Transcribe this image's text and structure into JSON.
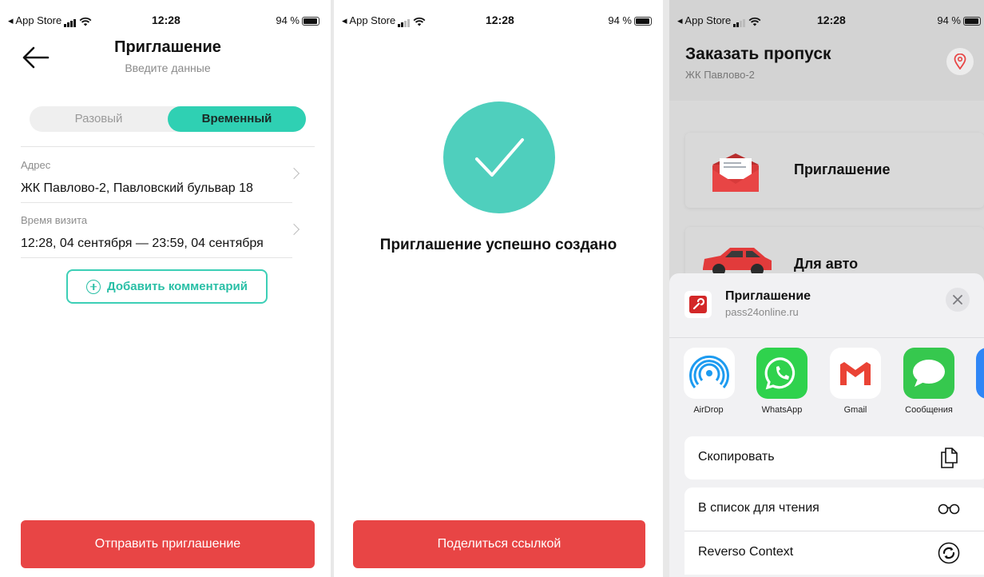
{
  "status_bar": {
    "back_app": "◂ App Store",
    "time": "12:28",
    "battery": "94 %"
  },
  "invite_screen": {
    "title": "Приглашение",
    "subtitle": "Введите данные",
    "segments": [
      "Разовый",
      "Временный"
    ],
    "selected_segment": "Временный",
    "address_label": "Адрес",
    "address_value": "ЖК Павлово-2, Павловский бульвар 18",
    "time_label": "Время визита",
    "time_value": "12:28, 04 сентября — 23:59, 04 сентября",
    "add_comment_label": "Добавить комментарий",
    "submit_label": "Отправить приглашение"
  },
  "success_screen": {
    "message": "Приглашение успешно создано",
    "share_label": "Поделиться ссылкой"
  },
  "pass_screen": {
    "title": "Заказать пропуск",
    "subtitle": "ЖК Павлово-2",
    "menu_items": [
      {
        "label": "Приглашение",
        "icon": "envelope-icon"
      },
      {
        "label": "Для авто",
        "icon": "car-icon"
      }
    ]
  },
  "share_sheet": {
    "title": "Приглашение",
    "url": "pass24online.ru",
    "apps": [
      {
        "label": "AirDrop",
        "icon": "airdrop-icon"
      },
      {
        "label": "WhatsApp",
        "icon": "whatsapp-icon"
      },
      {
        "label": "Gmail",
        "icon": "gmail-icon"
      },
      {
        "label": "Сообщения",
        "icon": "messages-icon"
      }
    ],
    "actions": [
      {
        "label": "Скопировать",
        "icon": "copy-icon"
      },
      {
        "label": "В список для чтения",
        "icon": "glasses-icon"
      },
      {
        "label": "Reverso Context",
        "icon": "reverso-icon"
      }
    ]
  },
  "colors": {
    "accent_teal": "#2fd0b3",
    "success_green": "#4fcfbd",
    "danger_red": "#e84545"
  }
}
